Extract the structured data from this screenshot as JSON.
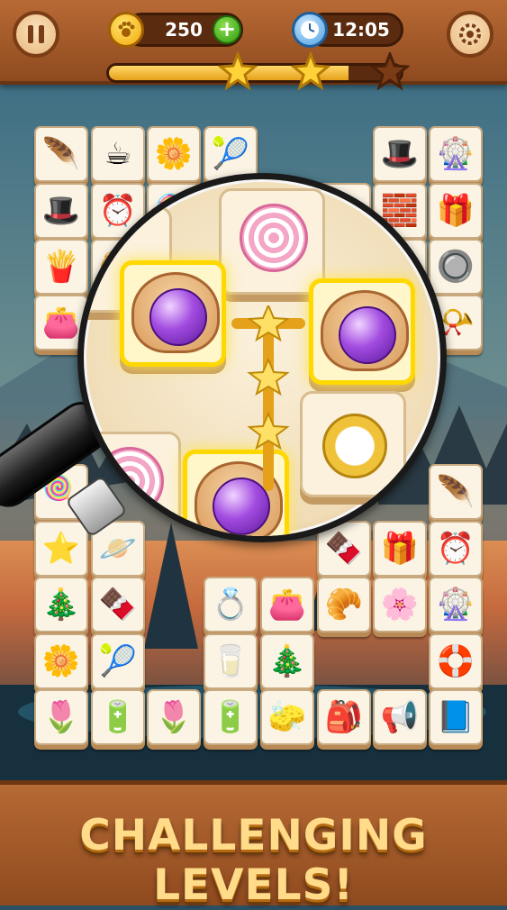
{
  "hud": {
    "coins": "250",
    "timer": "12:05",
    "level_progress": 0.82,
    "stars_earned": 2,
    "stars_total": 3
  },
  "icons": {
    "pause": "pause-icon",
    "coin": "paw-coin-icon",
    "add": "plus-icon",
    "clock": "alarm-clock-icon",
    "settings": "settings-icon"
  },
  "board": {
    "tiles": [
      "🪶",
      "☕",
      "🌼",
      "🎾",
      "🎩",
      "🎡",
      "🎩",
      "⏰",
      "🍭",
      "🧁",
      "💎",
      "🧱",
      "🎁",
      "🍟",
      "🥐",
      "🎡",
      "🔘",
      "👛",
      "🐚",
      "📯",
      "🍭",
      "🪶",
      "🪐",
      "⭐",
      "🐚",
      "🍫",
      "🎁",
      "⏰",
      "🎄",
      "🍫",
      "💍",
      "👛",
      "🥐",
      "🌸",
      "🎡",
      "🌼",
      "🎾",
      "🥛",
      "🎄",
      "🛟",
      "🌷",
      "🔋",
      "🌷",
      "🔋",
      "🧽",
      "🎒",
      "📢",
      "📘"
    ]
  },
  "banner": {
    "text": "CHALLENGING LEVELS!"
  },
  "colors": {
    "wood": "#a85a28",
    "banner_text": "#ffdb8a",
    "highlight": "#ffd800"
  }
}
